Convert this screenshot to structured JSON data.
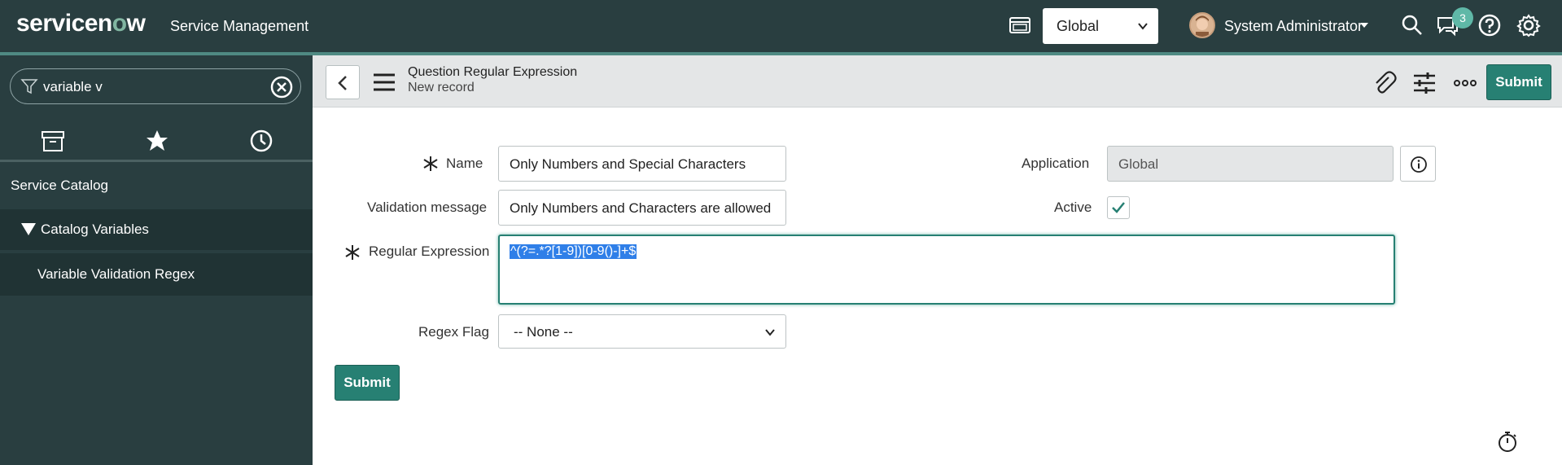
{
  "header": {
    "logo_text_1": "servicen",
    "logo_text_2": "o",
    "logo_text_3": "w",
    "app_title": "Service Management",
    "scope_value": "Global",
    "user_name": "System Administrator",
    "notification_count": "3",
    "icons": [
      "window-icon",
      "search-icon",
      "chat-icon",
      "help-icon",
      "gear-icon"
    ]
  },
  "sidebar": {
    "filter_value": "variable v",
    "tabs": [
      "archive-icon",
      "star-icon",
      "clock-icon"
    ],
    "section": "Service Catalog",
    "group": "Catalog Variables",
    "item": "Variable Validation Regex"
  },
  "form_header": {
    "title": "Question Regular Expression",
    "subtitle": "New record",
    "submit_label": "Submit",
    "icons": [
      "paperclip-icon",
      "sliders-icon",
      "more-icon"
    ]
  },
  "form": {
    "name_label": "Name",
    "name_value": "Only Numbers and Special Characters",
    "validation_label": "Validation message",
    "validation_value": "Only Numbers and Characters are allowed",
    "regex_label": "Regular Expression",
    "regex_value": "^(?=.*?[1-9])[0-9()-]+$",
    "regex_flag_label": "Regex Flag",
    "regex_flag_value": "-- None --",
    "application_label": "Application",
    "application_value": "Global",
    "active_label": "Active",
    "active_checked": true,
    "submit_label": "Submit"
  },
  "colors": {
    "header_bg": "#293e40",
    "accent": "#278073",
    "sidebar_active": "#203334"
  }
}
